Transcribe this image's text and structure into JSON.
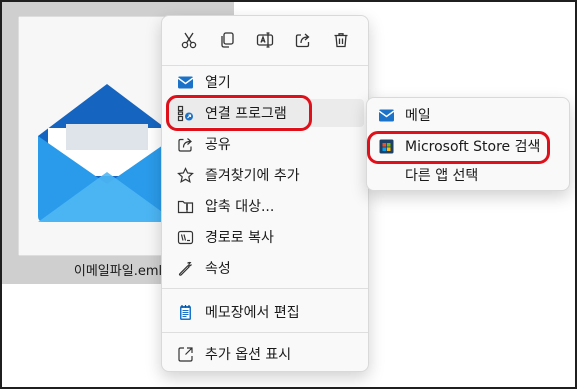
{
  "file": {
    "name": "이메일파일.eml",
    "icon": "mail-envelope-icon"
  },
  "toolbar": [
    {
      "icon": "cut-icon",
      "name": "cut-button"
    },
    {
      "icon": "copy-icon",
      "name": "copy-button"
    },
    {
      "icon": "rename-icon",
      "name": "rename-button"
    },
    {
      "icon": "share-icon",
      "name": "share-button"
    },
    {
      "icon": "delete-icon",
      "name": "delete-button"
    }
  ],
  "menu": {
    "items": [
      {
        "label": "열기",
        "icon": "mail-app-icon"
      },
      {
        "label": "연결 프로그램",
        "icon": "open-with-icon"
      },
      {
        "label": "공유",
        "icon": "share-icon"
      },
      {
        "label": "즐겨찾기에 추가",
        "icon": "star-icon"
      },
      {
        "label": "압축 대상...",
        "icon": "zip-folder-icon"
      },
      {
        "label": "경로로 복사",
        "icon": "copy-path-icon"
      },
      {
        "label": "속성",
        "icon": "wrench-icon"
      },
      {
        "label": "메모장에서 편집",
        "icon": "notepad-icon"
      },
      {
        "label": "추가 옵션 표시",
        "icon": "expand-icon"
      }
    ]
  },
  "submenu": {
    "items": [
      {
        "label": "메일",
        "icon": "mail-app-icon"
      },
      {
        "label": "Microsoft Store 검색",
        "icon": "store-icon"
      },
      {
        "label": "다른 앱 선택"
      }
    ]
  },
  "colors": {
    "highlight": "#e0101a",
    "accent": "#1a73c8"
  }
}
